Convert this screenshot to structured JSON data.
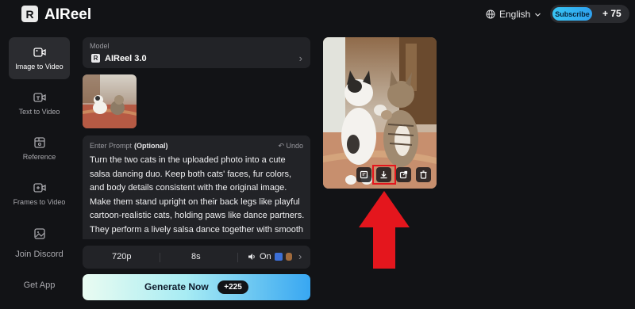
{
  "header": {
    "logo_letter": "R",
    "brand": "AIReel",
    "language": "English",
    "subscribe_label": "Subscribe",
    "credits": "+ 75"
  },
  "sidebar": {
    "items": [
      {
        "label": "Image to Video",
        "icon": "image-to-video-icon",
        "active": true
      },
      {
        "label": "Text to Video",
        "icon": "text-to-video-icon",
        "active": false
      },
      {
        "label": "Reference",
        "icon": "reference-icon",
        "active": false
      },
      {
        "label": "Frames to Video",
        "icon": "frames-to-video-icon",
        "active": false
      },
      {
        "label": "Join Discord",
        "icon": "discord-icon",
        "active": false
      }
    ],
    "get_app": "Get App"
  },
  "model": {
    "caption": "Model",
    "name": "AIReel 3.0"
  },
  "prompt": {
    "label": "Enter Prompt",
    "optional": "(Optional)",
    "undo": "↶ Undo",
    "text": "Turn the two cats in the uploaded photo into a cute salsa dancing duo. Keep both cats' faces, fur colors, and body details consistent with the original image. Make them stand upright on their back legs like playful cartoon-realistic cats, holding paws like dance partners. They perform a lively salsa dance together with smooth hip movement, small side steps, paw spins, and a cute"
  },
  "options": {
    "resolution": "720p",
    "duration": "8s",
    "sound": "On"
  },
  "generate": {
    "label": "Generate Now",
    "cost": "+225"
  },
  "preview_actions": [
    "edit-icon",
    "download-icon",
    "share-icon",
    "delete-icon"
  ],
  "colors": {
    "background": "#121316",
    "card": "#222327",
    "accent": "#38a7f2",
    "highlight": "#e4161d"
  }
}
